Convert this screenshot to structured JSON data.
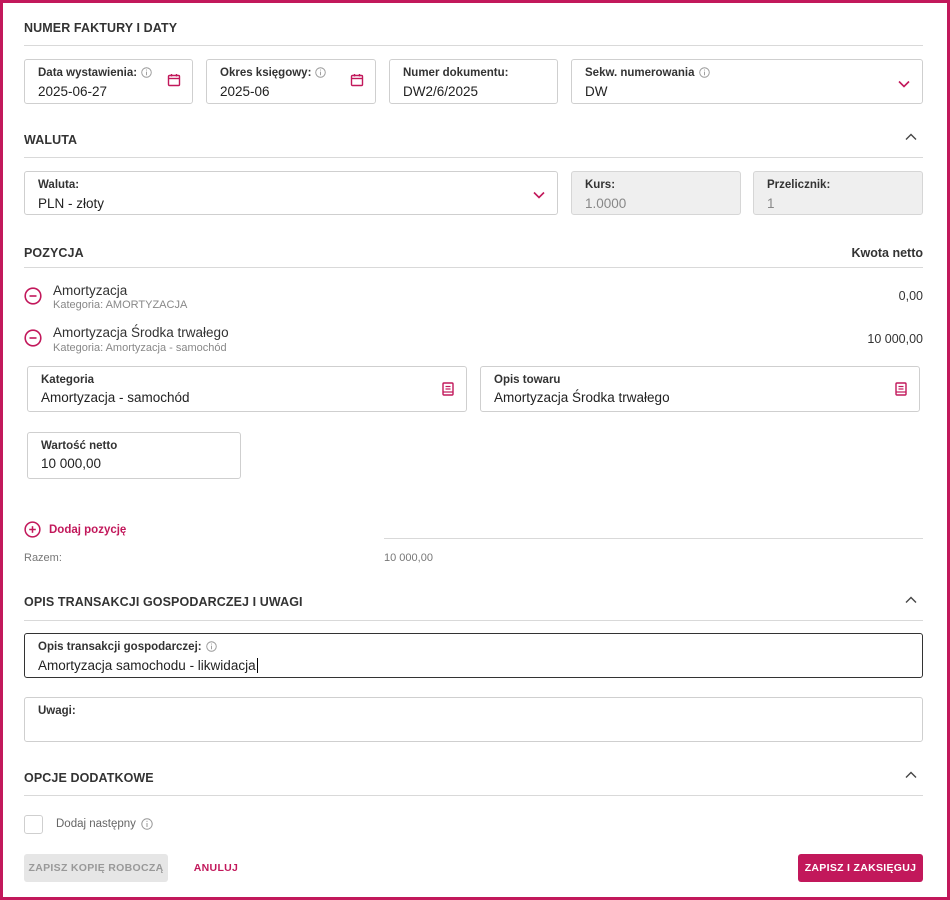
{
  "colors": {
    "accent": "#c2185b",
    "border": "#cfcfcf",
    "disabled_bg": "#efefef"
  },
  "sections": {
    "numbers": {
      "title": "NUMER FAKTURY I DATY",
      "issue_date": {
        "label": "Data wystawienia:",
        "value": "2025-06-27",
        "icon": "calendar-icon"
      },
      "period": {
        "label": "Okres księgowy:",
        "value": "2025-06",
        "icon": "calendar-icon"
      },
      "doc_number": {
        "label": "Numer dokumentu:",
        "value": "DW2/6/2025"
      },
      "sequence": {
        "label": "Sekw. numerowania",
        "value": "DW",
        "icon": "chevron-down-icon"
      }
    },
    "currency": {
      "title": "WALUTA",
      "currency": {
        "label": "Waluta:",
        "value": "PLN - złoty"
      },
      "rate": {
        "label": "Kurs:",
        "value": "1.0000"
      },
      "converter": {
        "label": "Przelicznik:",
        "value": "1"
      }
    },
    "positions": {
      "title": "POZYCJA",
      "net_header": "Kwota netto",
      "items": [
        {
          "name": "Amortyzacja",
          "category": "Kategoria: AMORTYZACJA",
          "amount": "0,00"
        },
        {
          "name": "Amortyzacja Środka trwałego",
          "category": "Kategoria: Amortyzacja - samochód",
          "amount": "10 000,00"
        }
      ],
      "edit": {
        "category": {
          "label": "Kategoria",
          "value": "Amortyzacja - samochód"
        },
        "description": {
          "label": "Opis towaru",
          "value": "Amortyzacja Środka trwałego"
        },
        "net_value": {
          "label": "Wartość netto",
          "value": "10 000,00"
        }
      },
      "add_label": "Dodaj pozycję",
      "total_label": "Razem:",
      "total_value": "10 000,00"
    },
    "description": {
      "title": "OPIS TRANSAKCJI GOSPODARCZEJ I UWAGI",
      "transaction": {
        "label": "Opis transakcji gospodarczej:",
        "value": "Amortyzacja samochodu - likwidacja"
      },
      "notes": {
        "label": "Uwagi:",
        "value": ""
      }
    },
    "options": {
      "title": "OPCJE DODATKOWE",
      "add_next_label": "Dodaj następny"
    }
  },
  "actions": {
    "draft": "ZAPISZ KOPIĘ ROBOCZĄ",
    "cancel": "ANULUJ",
    "save": "ZAPISZ I ZAKSIĘGUJ"
  }
}
